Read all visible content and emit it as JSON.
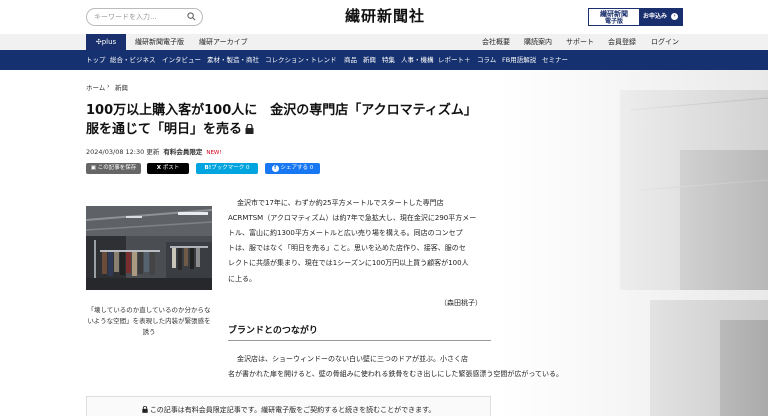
{
  "header": {
    "search_placeholder": "キーワードを入力...",
    "logo": "繊研新聞社",
    "edition_line1": "繊研新聞",
    "edition_line2": "電子版",
    "apply_label": "お申込み"
  },
  "nav": {
    "plus": "plus",
    "left_links": [
      "繊研新聞電子版",
      "繊研アーカイブ"
    ],
    "right_links": [
      "会社概要",
      "購読案内",
      "サポート",
      "会員登録",
      "ログイン"
    ]
  },
  "menu": [
    "トップ",
    "総合・ビジネス",
    "インタビュー",
    "素材・製造・商社",
    "コレクション・トレンド",
    "商品",
    "新興",
    "特集",
    "人事・機構",
    "レポート＋",
    "コラム",
    "FB用語解説",
    "セミナー"
  ],
  "breadcrumb": {
    "home": "ホーム",
    "sep": "›",
    "current": "新興"
  },
  "article": {
    "title_line1": "100万以上購入客が100人に　金沢の専門店「アクロマティズム」",
    "title_line2": "服を通じて「明日」を売る",
    "date": "2024/03/08 12:30 更新",
    "member": "有料会員限定",
    "new_badge": "NEW!",
    "caption": "「壊しているのか直しているのか分からないような空間」を表現した内装が緊張感を誘う",
    "para1": [
      "金沢市で17年に、わずか約25平方メートルでスタートした専門店",
      "ACRMTSM（アクロマティズム）は約7年で急拡大し、現在金沢に290平方メー",
      "トル、富山に約1300平方メートルと広い売り場を構える。同店のコンセプ",
      "トは、服ではなく「明日を売る」こと。思いを込めた店作り、接客、服のセ",
      "レクトに共感が集まり、現在では1シーズンに100万円以上買う顧客が100人",
      "に上る。"
    ],
    "author": "（森田桃子）",
    "subhead": "ブランドとのつながり",
    "para2": [
      "金沢店は、ショーウィンドーのない白い壁に三つのドアが並ぶ。小さく店",
      "名が書かれた扉を開けると、壁の骨組みに使われる鉄骨をむき出しにした緊張感漂う空間が広がっている。"
    ],
    "paywall": "この記事は有料会員限定記事です。繊研電子版をご契約すると続きを読むことができます。"
  },
  "share": {
    "save": "この記事を保存",
    "x": "ポスト",
    "hatena": "ブックマーク",
    "hatena_count": "0",
    "fb": "シェアする",
    "fb_count": "0"
  },
  "colors": {
    "navy": "#16316f",
    "new": "#d6001c",
    "hatena": "#00a4de",
    "facebook": "#1877f2"
  }
}
